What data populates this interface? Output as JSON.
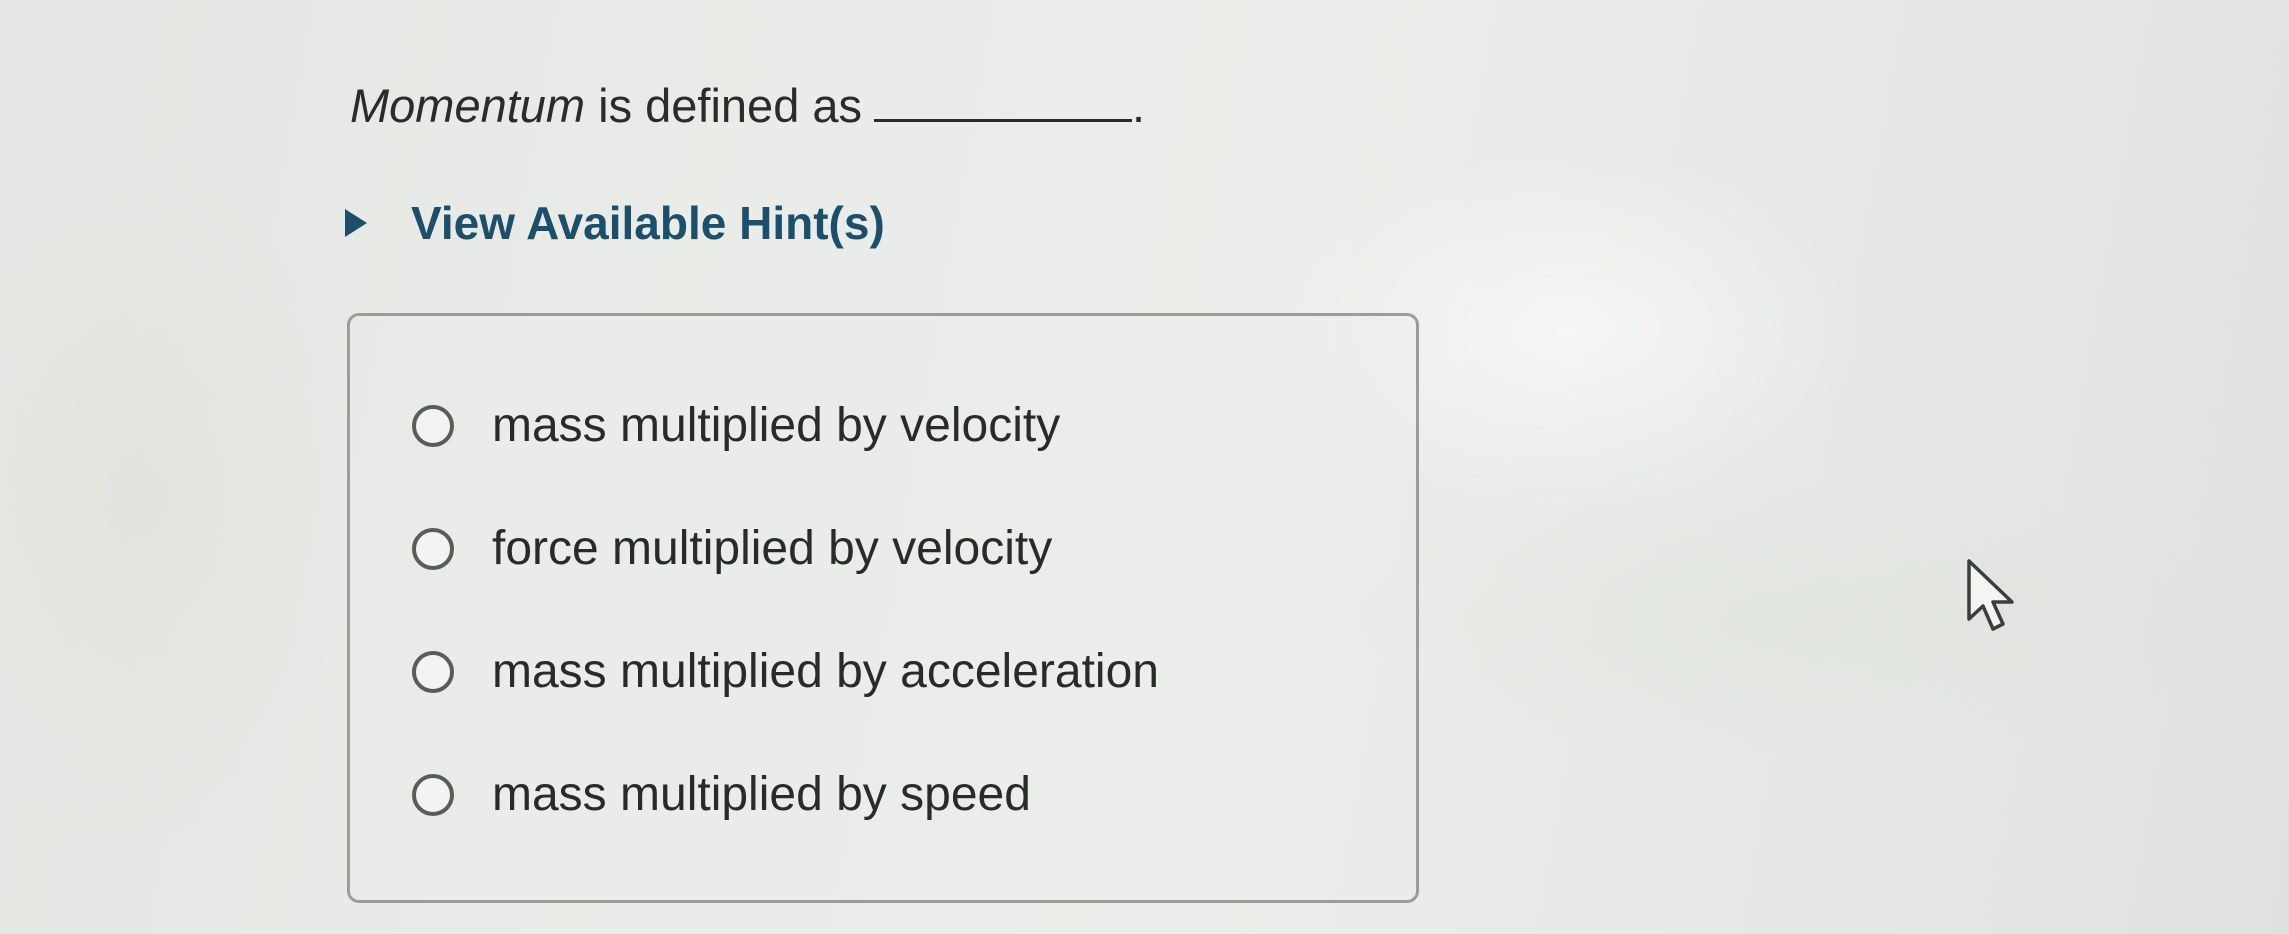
{
  "question": {
    "term": "Momentum",
    "rest": " is defined as",
    "end": "."
  },
  "hint_toggle": {
    "label": "View Available Hint(s)"
  },
  "options": [
    {
      "label": "mass multiplied by velocity",
      "selected": false
    },
    {
      "label": "force multiplied by velocity",
      "selected": false
    },
    {
      "label": "mass multiplied by acceleration",
      "selected": false
    },
    {
      "label": "mass multiplied by speed",
      "selected": false
    }
  ],
  "icons": {
    "hint_toggle": "caret-right-icon",
    "cursor": "mouse-pointer-icon",
    "option": "radio-button-icon"
  },
  "colors": {
    "hint_link": "#1d4f6a",
    "text": "#2b2b2b",
    "box_border": "#9b9d9c"
  }
}
